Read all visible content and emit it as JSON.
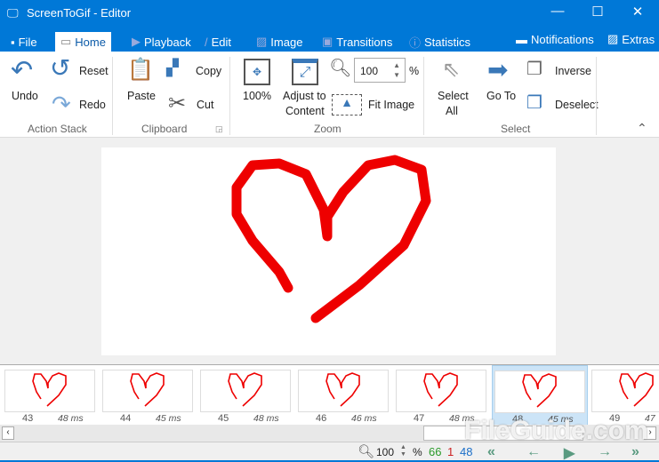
{
  "window": {
    "title": "ScreenToGif - Editor",
    "minimize": "—",
    "maximize": "☐",
    "close": "✕"
  },
  "tabs": [
    {
      "label": "File"
    },
    {
      "label": "Home"
    },
    {
      "label": "Playback"
    },
    {
      "label": "Edit"
    },
    {
      "label": "Image"
    },
    {
      "label": "Transitions"
    },
    {
      "label": "Statistics"
    }
  ],
  "right_tabs": {
    "notifications": "Notifications",
    "extras": "Extras"
  },
  "ribbon": {
    "action_stack": {
      "undo": "Undo",
      "reset": "Reset",
      "redo": "Redo",
      "group": "Action Stack"
    },
    "clipboard": {
      "paste": "Paste",
      "copy": "Copy",
      "cut": "Cut",
      "group": "Clipboard"
    },
    "zoom": {
      "actual": "100%",
      "adjust": "Adjust to",
      "adjust2": "Content",
      "fit": "Fit Image",
      "value": "100",
      "unit": "%",
      "group": "Zoom"
    },
    "select": {
      "select_all": "Select",
      "select_all2": "All",
      "go_to": "Go To",
      "inverse": "Inverse",
      "deselect": "Deselect",
      "group": "Select"
    }
  },
  "frames": [
    {
      "n": "43",
      "ms": "48 ms"
    },
    {
      "n": "44",
      "ms": "45 ms"
    },
    {
      "n": "45",
      "ms": "48 ms"
    },
    {
      "n": "46",
      "ms": "46 ms"
    },
    {
      "n": "47",
      "ms": "48 ms"
    },
    {
      "n": "48",
      "ms": "45 ms",
      "selected": true
    },
    {
      "n": "49",
      "ms": "47"
    }
  ],
  "status": {
    "zoom": "100",
    "unit": "%",
    "total": "66",
    "selected_count": "1",
    "current": "48"
  },
  "colors": {
    "accent": "#0078d7",
    "heart": "#ee0000",
    "total": "#2a9a2a",
    "selected": "#cc2222",
    "current": "#1a6ec8"
  },
  "watermark": "FileGuide.com"
}
